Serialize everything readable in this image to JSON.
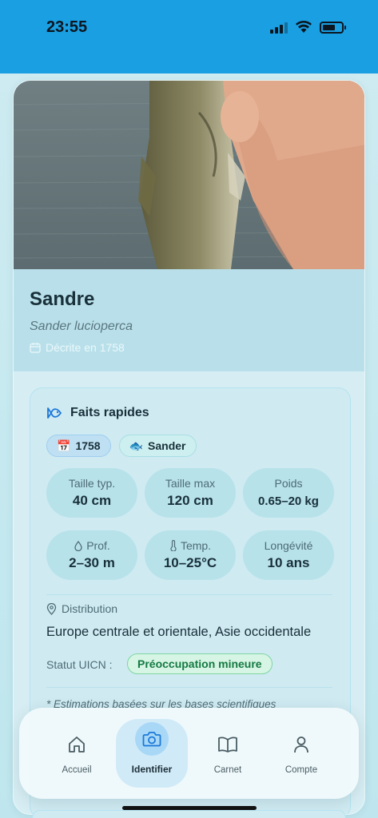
{
  "status_bar": {
    "time": "23:55"
  },
  "species": {
    "common_name": "Sandre",
    "scientific_name": "Sander lucioperca",
    "described": "Décrite en 1758"
  },
  "quick_facts": {
    "title": "Faits rapides",
    "chips": [
      {
        "emoji": "📅",
        "label": "1758"
      },
      {
        "emoji": "🐟",
        "label": "Sander"
      }
    ],
    "stats": [
      {
        "label": "Taille typ.",
        "value": "40 cm"
      },
      {
        "label": "Taille max",
        "value": "120 cm"
      },
      {
        "label": "Poids",
        "value": "0.65–20 kg"
      },
      {
        "label": "Prof.",
        "value": "2–30 m"
      },
      {
        "label": "Temp.",
        "value": "10–25°C"
      },
      {
        "label": "Longévité",
        "value": "10 ans"
      }
    ],
    "distribution_label": "Distribution",
    "distribution_value": "Europe centrale et orientale, Asie occidentale",
    "iucn_label": "Statut UICN :",
    "iucn_status": "Préoccupation mineure",
    "note": "* Estimations basées sur les bases scientifiques"
  },
  "tabbar": {
    "items": [
      {
        "label": "Accueil",
        "icon": "home-icon"
      },
      {
        "label": "Identifier",
        "icon": "camera-icon",
        "active": true
      },
      {
        "label": "Carnet",
        "icon": "book-icon"
      },
      {
        "label": "Compte",
        "icon": "person-icon"
      }
    ]
  },
  "colors": {
    "status_bar": "#1a9fe2",
    "background": "#bfe6ee",
    "iucn_badge": "#137a42",
    "active_tab": "#a9d8f6"
  }
}
